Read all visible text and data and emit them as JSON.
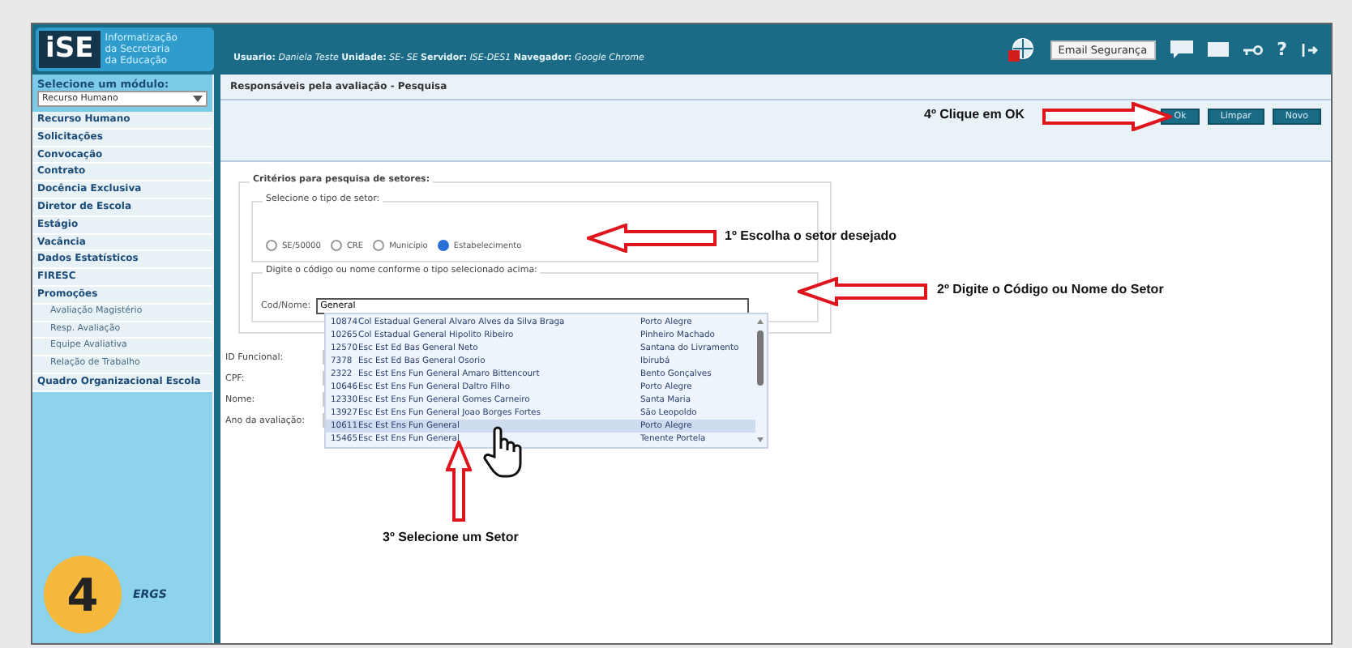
{
  "header": {
    "logo_text": "iSE",
    "logo_caption": [
      "Informatização",
      "da Secretaria",
      "da Educação"
    ],
    "user_info": "**Usuario:** *Daniela Teste* **Unidade:** *SE- SE* **Servidor:** *ISE-DES1* **Navegador:** *Google Chrome*",
    "email_button": "Email Segurança",
    "help": "?"
  },
  "sidebar": {
    "module_label": "Selecione um módulo:",
    "module_value": "Recurso Humano",
    "menu": [
      {
        "label": "Recurso Humano"
      },
      {
        "label": "Solicitações"
      },
      {
        "label": "Convocação"
      },
      {
        "label": "Contrato"
      },
      {
        "label": "Docência Exclusiva"
      },
      {
        "label": "Diretor de Escola"
      },
      {
        "label": "Estágio"
      },
      {
        "label": "Vacância"
      },
      {
        "label": "Dados Estatísticos"
      },
      {
        "label": "FIRESC"
      },
      {
        "label": "Promoções",
        "children": [
          {
            "label": "Avaliação Magistério"
          },
          {
            "label": "Resp. Avaliação"
          },
          {
            "label": "Equipe Avaliativa"
          },
          {
            "label": "Relação de Trabalho"
          }
        ]
      },
      {
        "label": "Quadro Organizacional Escola"
      }
    ],
    "footer_logo": "ERGS"
  },
  "page_title": "Responsáveis pela avaliação - Pesquisa",
  "toolbar_buttons": [
    "Ok",
    "Limpar",
    "Novo"
  ],
  "criteria": {
    "title": "Critérios para pesquisa de setores:",
    "sector_type": {
      "legend": "Selecione o tipo de setor:",
      "options": [
        {
          "label": "SE/50000",
          "selected": false
        },
        {
          "label": "CRE",
          "selected": false
        },
        {
          "label": "Município",
          "selected": false
        },
        {
          "label": "Estabelecimento",
          "selected": true
        }
      ]
    },
    "search": {
      "legend": "Digite o código ou nome conforme o tipo selecionado acima:",
      "label": "Cod/Nome:",
      "value": "General"
    }
  },
  "results": [
    {
      "code": "10874",
      "name": "Col Estadual General Alvaro Alves da Silva Braga",
      "city": "Porto Alegre",
      "selected": false
    },
    {
      "code": "10265",
      "name": "Col Estadual General Hipolito Ribeiro",
      "city": "Pinheiro Machado",
      "selected": false
    },
    {
      "code": "12570",
      "name": "Esc Est Ed Bas General Neto",
      "city": "Santana do Livramento",
      "selected": false
    },
    {
      "code": "7378",
      "name": "Esc Est Ed Bas General Osorio",
      "city": "Ibirubá",
      "selected": false
    },
    {
      "code": "2322",
      "name": "Esc Est Ens Fun General Amaro Bittencourt",
      "city": "Bento Gonçalves",
      "selected": false
    },
    {
      "code": "10646",
      "name": "Esc Est Ens Fun General Daltro Filho",
      "city": "Porto Alegre",
      "selected": false
    },
    {
      "code": "12330",
      "name": "Esc Est Ens Fun General Gomes Carneiro",
      "city": "Santa Maria",
      "selected": false
    },
    {
      "code": "13927",
      "name": "Esc Est Ens Fun General Joao Borges Fortes",
      "city": "São Leopoldo",
      "selected": false
    },
    {
      "code": "10611",
      "name": "Esc Est Ens Fun General",
      "city": "Porto Alegre",
      "selected": true
    },
    {
      "code": "15465",
      "name": "Esc Est Ens Fun General",
      "city": "Tenente Portela",
      "selected": false
    }
  ],
  "fields": [
    "ID Funcional:",
    "CPF:",
    "Nome:",
    "Ano da avaliação:"
  ],
  "annotations": [
    {
      "text": "4º Clique em OK",
      "kind": "right"
    },
    {
      "text": "1º Escolha o setor desejado",
      "kind": "left"
    },
    {
      "text": "2º Digite o Código ou Nome do Setor",
      "kind": "left"
    },
    {
      "text": "3º Selecione um Setor",
      "kind": "up"
    }
  ],
  "step_badge": "4"
}
